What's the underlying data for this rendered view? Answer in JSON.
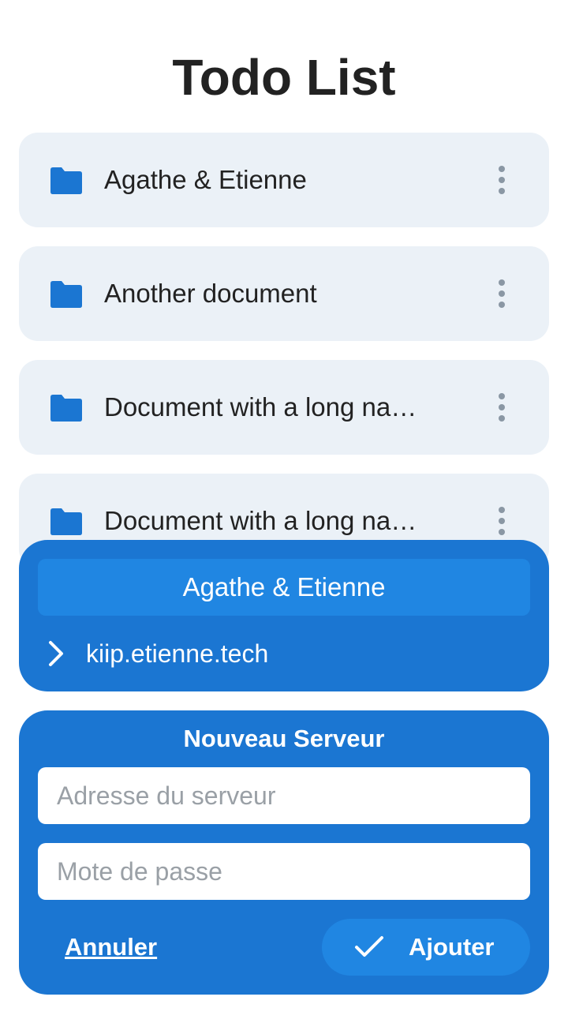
{
  "app": {
    "title": "Todo List"
  },
  "colors": {
    "accent": "#1b76d2",
    "accent_light": "#2086e2",
    "item_background": "#ebf1f7",
    "text": "#222222",
    "muted_icon": "#8a97a4"
  },
  "documents": [
    {
      "label": "Agathe & Etienne",
      "icon": "folder-icon",
      "menu_icon": "more-vertical-icon"
    },
    {
      "label": "Another document",
      "icon": "folder-icon",
      "menu_icon": "more-vertical-icon"
    },
    {
      "label": "Document with a long na…",
      "icon": "folder-icon",
      "menu_icon": "more-vertical-icon"
    },
    {
      "label": "Document with a long na…",
      "icon": "folder-icon",
      "menu_icon": "more-vertical-icon"
    }
  ],
  "server_panel": {
    "selected_document": "Agathe & Etienne",
    "server_url": "kiip.etienne.tech",
    "expand_icon": "chevron-right-icon"
  },
  "new_server": {
    "heading": "Nouveau Serveur",
    "address_placeholder": "Adresse du serveur",
    "address_value": "",
    "password_placeholder": "Mote de passe",
    "password_value": "",
    "cancel_label": "Annuler",
    "add_label": "Ajouter",
    "add_icon": "check-icon"
  }
}
